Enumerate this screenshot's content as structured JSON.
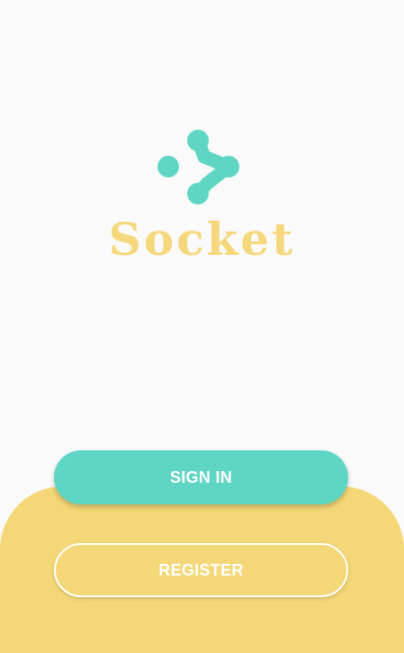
{
  "brand": {
    "name": "Socket",
    "logo_icon": "socket-logo-icon"
  },
  "colors": {
    "background": "#fafafa",
    "accent_teal": "#5fd6c3",
    "accent_yellow": "#f4d776",
    "wordmark": "#f5d77c"
  },
  "actions": {
    "sign_in_label": "SIGN IN",
    "register_label": "REGISTER"
  }
}
